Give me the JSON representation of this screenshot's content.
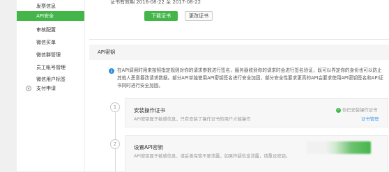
{
  "sidebar": {
    "items": [
      {
        "label": "发票信息"
      },
      {
        "label": "API安全"
      },
      {
        "label": "审核配置"
      },
      {
        "label": "微信买单"
      },
      {
        "label": "微信群管理"
      },
      {
        "label": "员工帐号管理"
      },
      {
        "label": "微信用户标签"
      }
    ],
    "group_label": "支付申请"
  },
  "certificate": {
    "valid_dates": "证书有效期      2016-08-22   至   2017-08-22",
    "download_label": "下载证书",
    "change_label": "更改证书"
  },
  "api_key": {
    "section_title": "API密钥",
    "notice": "在API调用时用来按照指定规则对你的请求参数进行签名，服务器收到你的请求时会进行签名验证，既可以界定你的身份也可以防止其他人恶意篡改请求数据。部分API单独使用API密钥签名进行安全加固，部分安全性要求更高的API会要求使用API密钥签名和API证书同时进行安全加固。",
    "steps": [
      {
        "number": "1",
        "title": "安装操作证书",
        "desc": "API密钥属于敏感信息，只有安装了操作证书的用户才能操作",
        "status": "你已安装操作证书",
        "link": "证书管理"
      },
      {
        "number": "2",
        "title": "设置API密钥",
        "desc": "API密钥属于敏感信息，请妥善保管不要泄露，如果怀疑信息泄露，请重设密钥。"
      }
    ]
  },
  "colors": {
    "accent": "#44b549",
    "link": "#459ae9",
    "info": "#2f8ee0"
  },
  "icons": {
    "info": "info-icon",
    "check": "check-circle-icon",
    "pay": "pay-circle-icon"
  }
}
